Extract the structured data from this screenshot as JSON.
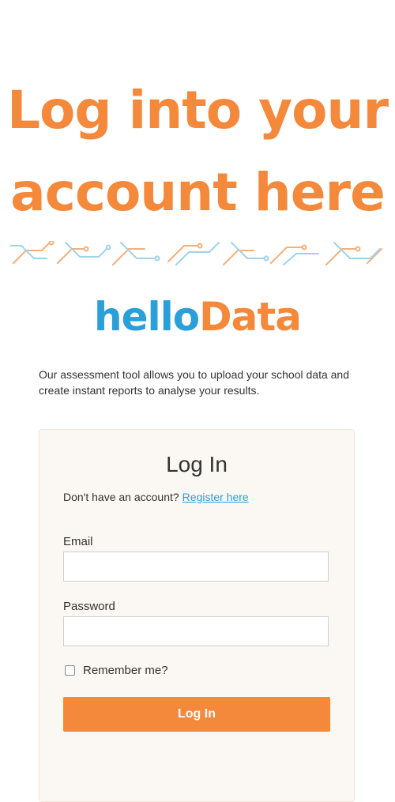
{
  "headline": {
    "line1": "Log into your",
    "line2": "account here"
  },
  "brand": {
    "part1": "hello",
    "part2": "Data"
  },
  "intro": "Our assessment tool allows you to upload your school data and create instant reports to analyse your results.",
  "login": {
    "title": "Log In",
    "signup_prompt": "Don't have an account?",
    "signup_link": "Register here",
    "email_label": "Email",
    "email_value": "",
    "password_label": "Password",
    "password_value": "",
    "remember_label": "Remember me?",
    "remember_checked": false,
    "submit_label": "Log In"
  },
  "colors": {
    "orange": "#f5893b",
    "blue": "#2a9fd8",
    "card_bg": "#fbf7f2"
  }
}
